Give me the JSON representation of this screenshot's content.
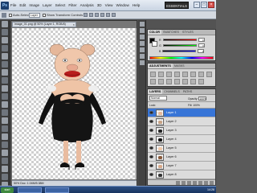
{
  "app": {
    "logo": "Ps",
    "menu": [
      "File",
      "Edit",
      "Image",
      "Layer",
      "Select",
      "Filter",
      "Analysis",
      "3D",
      "View",
      "Window",
      "Help"
    ],
    "zoom": "50%",
    "workspace": "ESSENTIALS",
    "window_buttons": [
      "−",
      "□",
      "×"
    ]
  },
  "options": {
    "auto_select_label": "Auto-Select:",
    "auto_select_value": "Layer",
    "transform_label": "Show Transform Controls"
  },
  "document": {
    "tab_title": "image_01.png @ 50% (Layer 1, RGB/8)",
    "tab_close": "×",
    "status": "50%   Doc: 1.04M/5.38M"
  },
  "color_panel": {
    "tabs": [
      "COLOR",
      "SWATCHES",
      "STYLES"
    ],
    "channels": [
      {
        "label": "R",
        "value": "0",
        "gradient": [
          "#000000",
          "#ff0000"
        ]
      },
      {
        "label": "G",
        "value": "0",
        "gradient": [
          "#000000",
          "#00ff00"
        ]
      },
      {
        "label": "B",
        "value": "0",
        "gradient": [
          "#000000",
          "#0000ff"
        ]
      }
    ]
  },
  "adjustments_panel": {
    "tabs": [
      "ADJUSTMENTS",
      "MASKS"
    ]
  },
  "layers_panel": {
    "tabs": [
      "LAYERS",
      "CHANNELS",
      "PATHS"
    ],
    "blend_mode": "Normal",
    "opacity_label": "Opacity:",
    "opacity_value": "100%",
    "lock_label": "Lock:",
    "fill_label": "Fill:",
    "fill_value": "100%",
    "layers": [
      {
        "name": "Layer 1",
        "selected": true,
        "thumb": "#e8b898"
      },
      {
        "name": "Layer 2",
        "selected": false,
        "thumb": "#c9a283"
      },
      {
        "name": "Layer 3",
        "selected": false,
        "thumb": "#222222"
      },
      {
        "name": "Layer 4",
        "selected": false,
        "thumb": "#111111"
      },
      {
        "name": "Layer 5",
        "selected": false,
        "thumb": "#f0c8a8"
      },
      {
        "name": "Layer 6",
        "selected": false,
        "thumb": "#8a5a3a"
      },
      {
        "name": "Layer 7",
        "selected": false,
        "thumb": "#d8a888"
      },
      {
        "name": "Layer 8",
        "selected": false,
        "thumb": "#333333"
      },
      {
        "name": "Layer 9",
        "selected": false,
        "thumb": "#e0b090"
      }
    ]
  },
  "taskbar": {
    "start": "start",
    "clock": "14:26"
  }
}
